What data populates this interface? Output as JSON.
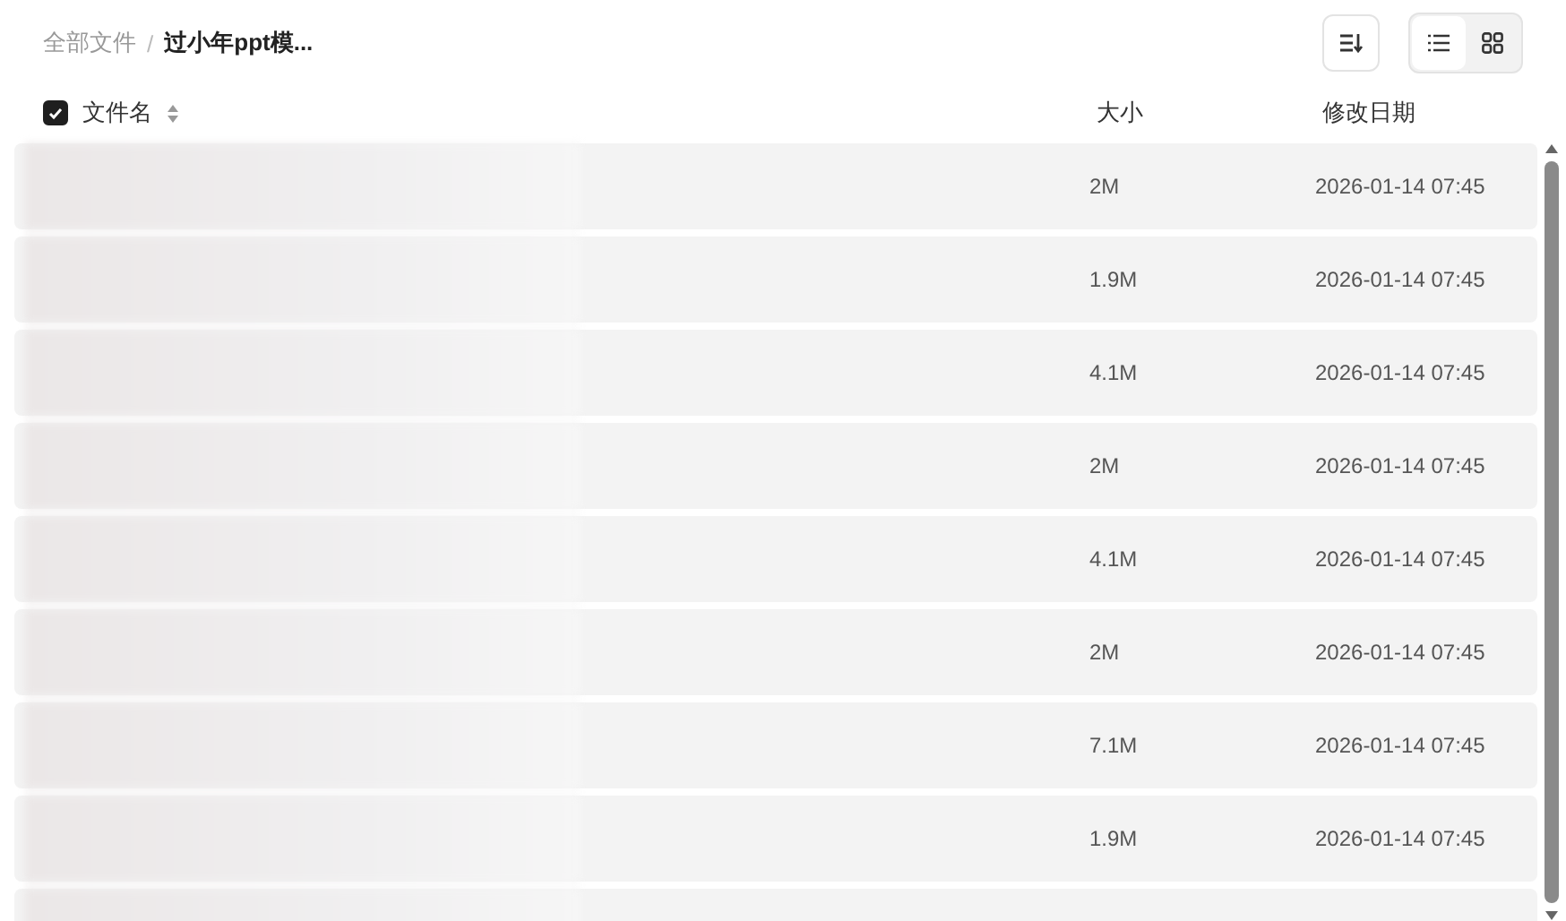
{
  "breadcrumb": {
    "separator": "/",
    "items": [
      {
        "label": "全部文件",
        "current": false
      },
      {
        "label": "过小年ppt模...",
        "current": true
      }
    ]
  },
  "view_toggle": [
    {
      "kind": "list",
      "selected": true
    },
    {
      "kind": "grid",
      "selected": false
    }
  ],
  "table": {
    "select_all_checked": true,
    "columns": [
      "文件名",
      "大小",
      "修改日期"
    ],
    "rows": [
      {
        "size": "2M",
        "modified": "2026-01-14 07:45"
      },
      {
        "size": "1.9M",
        "modified": "2026-01-14 07:45"
      },
      {
        "size": "4.1M",
        "modified": "2026-01-14 07:45"
      },
      {
        "size": "2M",
        "modified": "2026-01-14 07:45"
      },
      {
        "size": "4.1M",
        "modified": "2026-01-14 07:45"
      },
      {
        "size": "2M",
        "modified": "2026-01-14 07:45"
      },
      {
        "size": "7.1M",
        "modified": "2026-01-14 07:45"
      },
      {
        "size": "1.9M",
        "modified": "2026-01-14 07:45"
      }
    ]
  }
}
